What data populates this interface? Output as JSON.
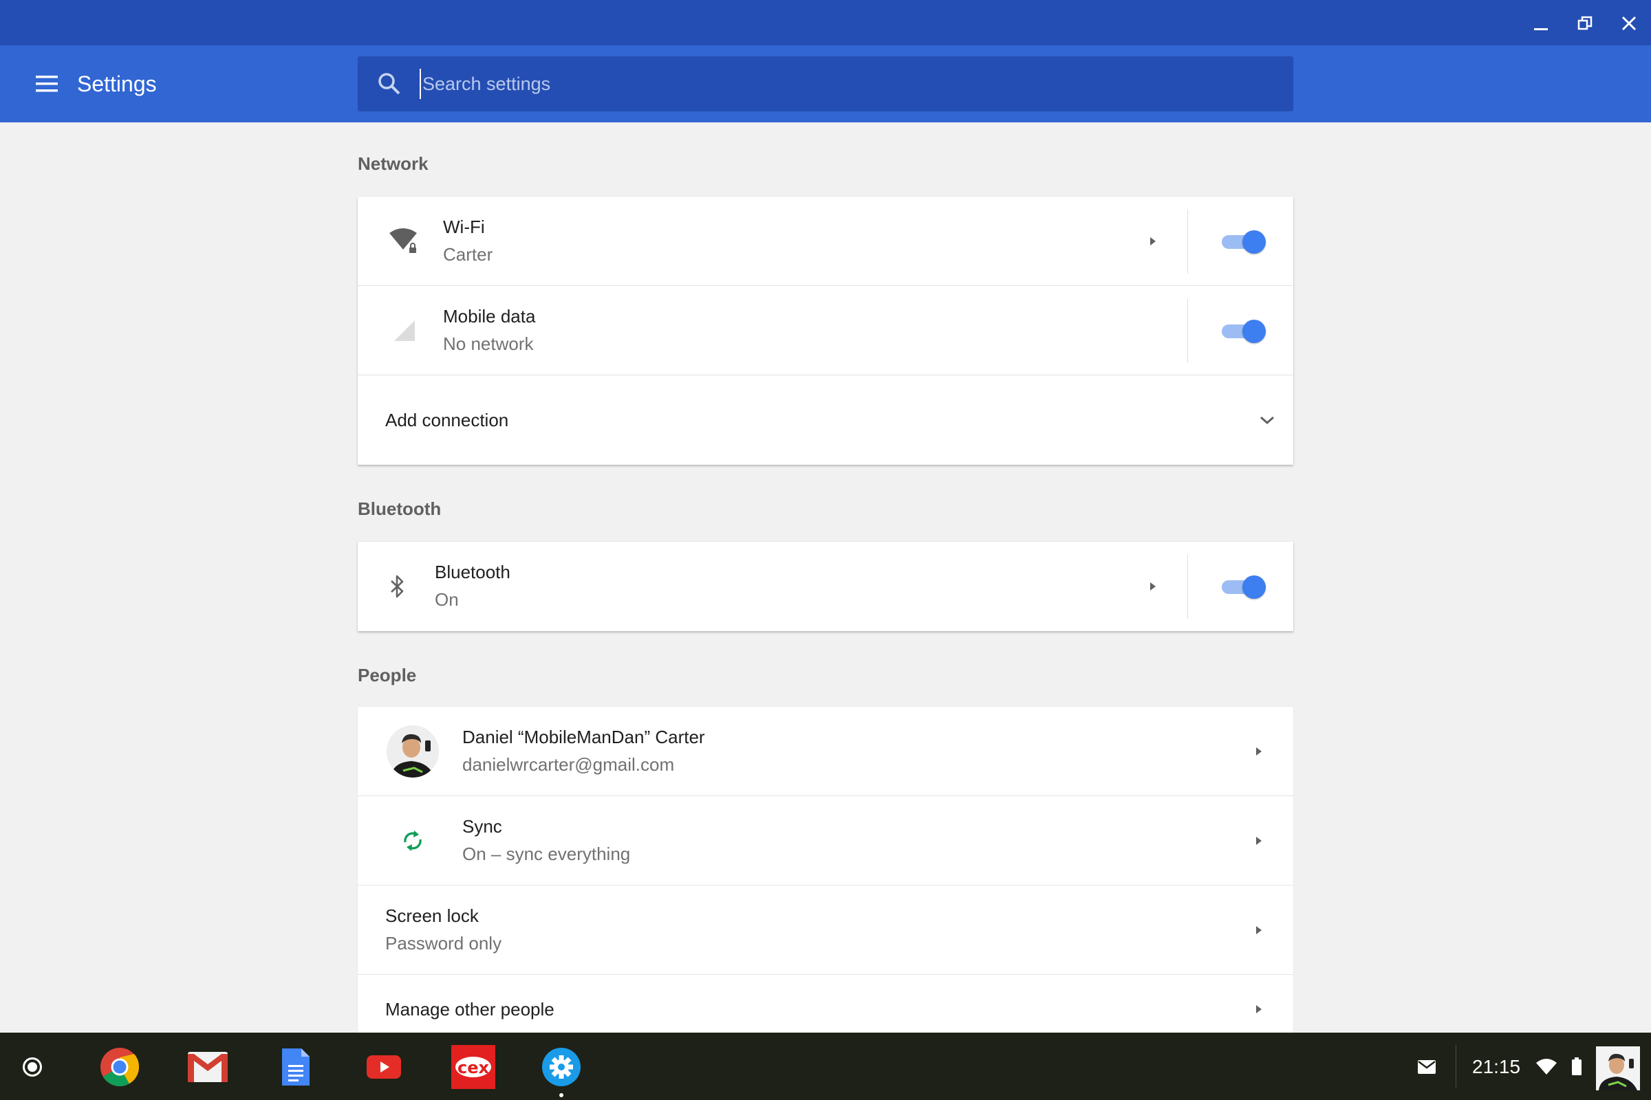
{
  "window": {
    "controls": [
      "minimize-icon",
      "restore-icon",
      "close-icon"
    ]
  },
  "header": {
    "menu_icon": "menu-icon",
    "title": "Settings",
    "search": {
      "placeholder": "Search settings",
      "value": ""
    }
  },
  "sections": {
    "network": {
      "title": "Network",
      "wifi": {
        "label": "Wi-Fi",
        "sub": "Carter",
        "icon": "wifi-lock-icon",
        "toggle_on": true
      },
      "mobile": {
        "label": "Mobile data",
        "sub": "No network",
        "icon": "mobile-signal-icon",
        "toggle_on": true
      },
      "add_connection": {
        "label": "Add connection",
        "icon": "chevron-down-icon"
      }
    },
    "bluetooth": {
      "title": "Bluetooth",
      "bluetooth": {
        "label": "Bluetooth",
        "sub": "On",
        "icon": "bluetooth-icon",
        "toggle_on": true
      }
    },
    "people": {
      "title": "People",
      "account": {
        "name": "Daniel “MobileManDan” Carter",
        "email": "danielwrcarter@gmail.com"
      },
      "sync": {
        "label": "Sync",
        "sub": "On – sync everything",
        "icon": "sync-icon"
      },
      "screen_lock": {
        "label": "Screen lock",
        "sub": "Password only"
      },
      "manage_people": {
        "label": "Manage other people"
      }
    }
  },
  "shelf": {
    "apps": [
      "chrome-icon",
      "gmail-icon",
      "docs-icon",
      "youtube-icon",
      "cex-icon",
      "settings-app-icon"
    ],
    "cex_label": "cex",
    "clock": "21:15",
    "tray": [
      "notification-icon",
      "wifi-icon",
      "battery-icon",
      "user-avatar"
    ]
  },
  "colors": {
    "titlebar": "#244eb3",
    "appbar": "#3166d3",
    "search_bg": "#244eb3",
    "toggle_knob": "#3d7ef0",
    "toggle_track": "#9cbcf4",
    "shelf": "#1e2117"
  }
}
